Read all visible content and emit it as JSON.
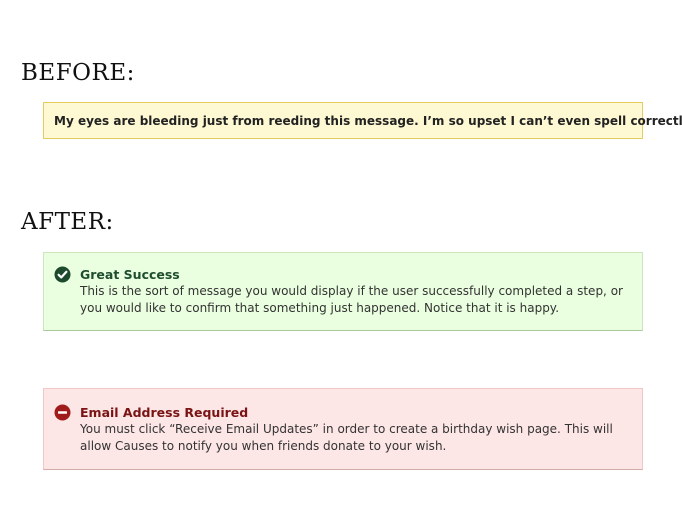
{
  "before": {
    "heading": "BEFORE:",
    "message": "My eyes are bleeding just from reeding this message. I’m so upset I can’t even spell correctly."
  },
  "after": {
    "heading": "AFTER:",
    "success": {
      "icon": "check-circle-icon",
      "title": "Great Success",
      "body": "This is the sort of message you would display if the user successfully completed a step, or you would like to confirm that something just happened. Notice that it is happy."
    },
    "error": {
      "icon": "minus-circle-icon",
      "title": "Email Address Required",
      "body": "You must click “Receive Email Updates” in order to create a birthday wish page. This will allow Causes to notify you when friends donate to your wish."
    }
  },
  "colors": {
    "warning_bg": "#fef9d3",
    "warning_border": "#e2cd5e",
    "success_bg": "#eaffdf",
    "success_icon": "#1d4a2c",
    "error_bg": "#fde6e6",
    "error_icon": "#a01c1c"
  }
}
